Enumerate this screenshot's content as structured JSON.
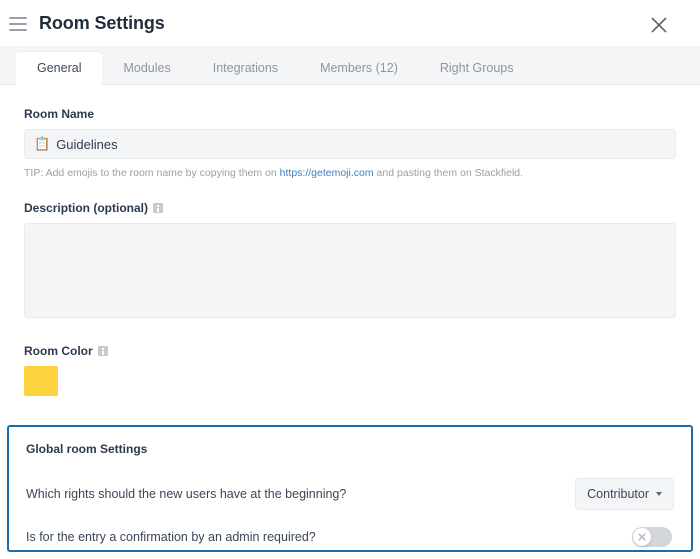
{
  "header": {
    "title": "Room Settings",
    "menu_icon": "hamburger-icon",
    "close_icon": "close-icon"
  },
  "tabs": [
    {
      "label": "General",
      "active": true
    },
    {
      "label": "Modules",
      "active": false
    },
    {
      "label": "Integrations",
      "active": false
    },
    {
      "label": "Members (12)",
      "active": false
    },
    {
      "label": "Right Groups",
      "active": false
    }
  ],
  "form": {
    "room_name": {
      "label": "Room Name",
      "emoji": "📋",
      "value": "Guidelines",
      "tip_prefix": "TIP: Add emojis to the room name by copying them on ",
      "tip_link": "https://getemoji.com",
      "tip_suffix": " and pasting them on Stackfield."
    },
    "description": {
      "label": "Description (optional)",
      "value": "",
      "placeholder": ""
    },
    "room_color": {
      "label": "Room Color",
      "value": "#fcd33f"
    }
  },
  "global_settings": {
    "title": "Global room Settings",
    "rights_question": "Which rights should the new users have at the beginning?",
    "rights_value": "Contributor",
    "confirmation_question": "Is for the entry a confirmation by an admin required?",
    "confirmation_enabled": false
  },
  "colors": {
    "panel_border": "#1b6cab",
    "link": "#3d7fc1",
    "room_color": "#fcd33f",
    "tabbar_bg": "#f4f5f7"
  }
}
